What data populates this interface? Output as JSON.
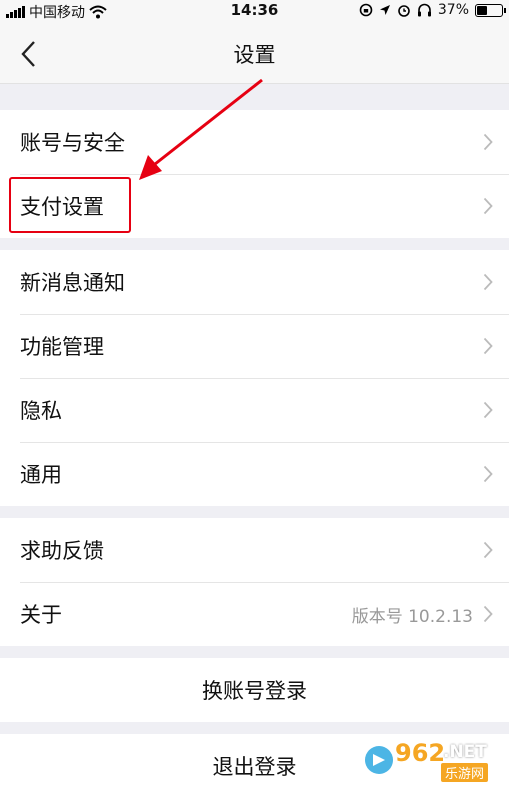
{
  "status_bar": {
    "carrier": "中国移动",
    "time": "14:36",
    "battery": "37%",
    "battery_level": 0.37
  },
  "nav": {
    "title": "设置"
  },
  "groups": [
    {
      "items": [
        {
          "label": "账号与安全"
        },
        {
          "label": "支付设置"
        }
      ]
    },
    {
      "items": [
        {
          "label": "新消息通知"
        },
        {
          "label": "功能管理"
        },
        {
          "label": "隐私"
        },
        {
          "label": "通用"
        }
      ]
    },
    {
      "items": [
        {
          "label": "求助反馈"
        },
        {
          "label": "关于",
          "value": "版本号 10.2.13"
        }
      ]
    }
  ],
  "actions": {
    "switch_account": "换账号登录",
    "logout": "退出登录"
  },
  "watermark": {
    "number": "962",
    "net": ".NET",
    "sub": "乐游网"
  },
  "colors": {
    "highlight": "#e60012",
    "chevron": "#bbbbbb",
    "background": "#efeff4"
  }
}
